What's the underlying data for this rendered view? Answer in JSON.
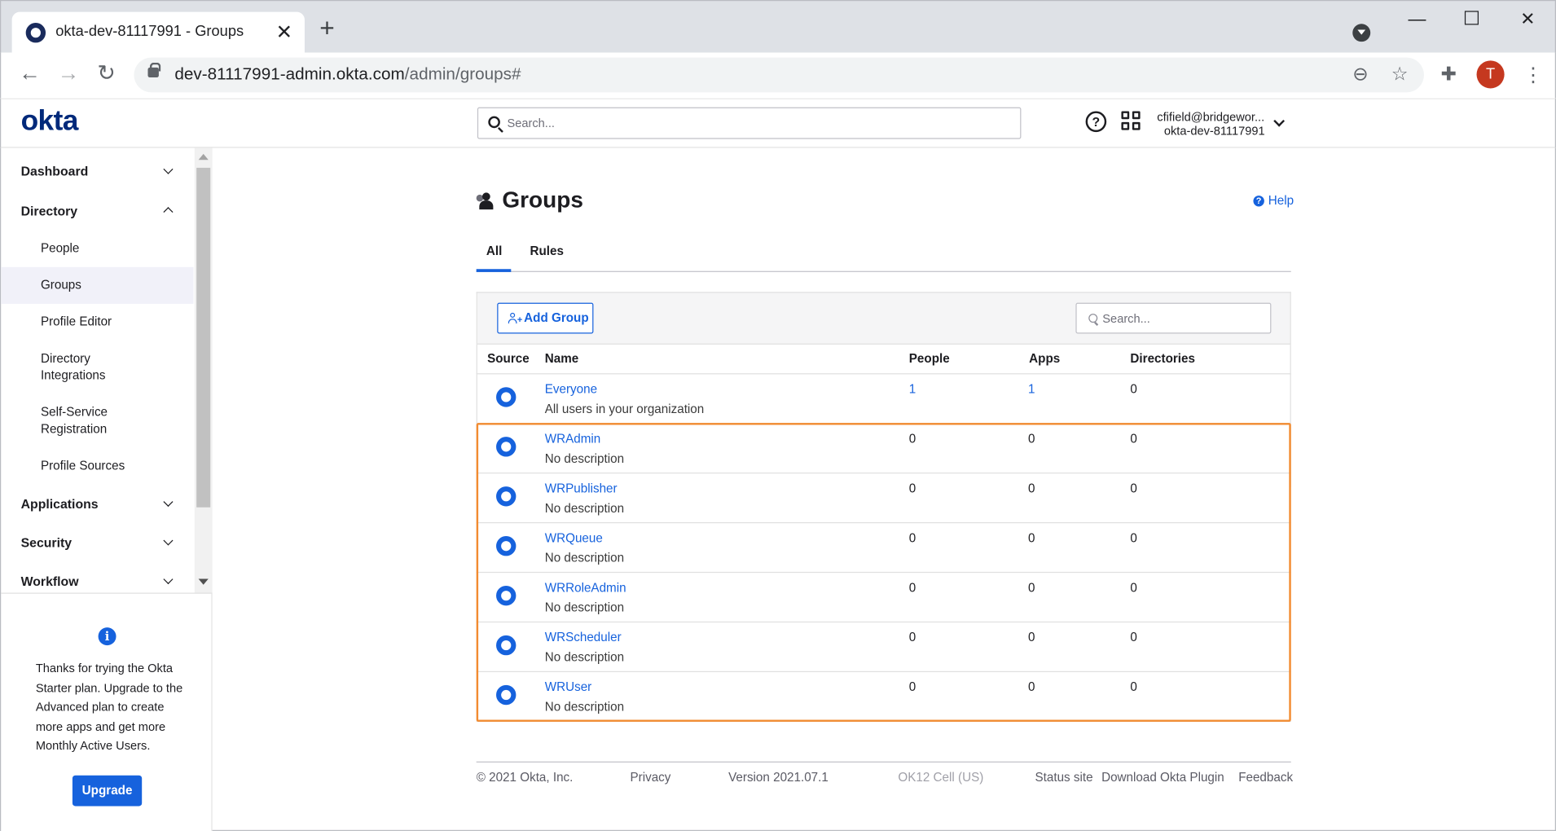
{
  "browser": {
    "tab_title": "okta-dev-81117991 - Groups",
    "url_host": "dev-81117991-admin.okta.com",
    "url_path": "/admin/groups#",
    "profile_initial": "T"
  },
  "header": {
    "logo": "okta",
    "search_placeholder": "Search...",
    "user_email": "cfifield@bridgewor...",
    "user_org": "okta-dev-81117991"
  },
  "sidebar": {
    "dashboard": "Dashboard",
    "directory": "Directory",
    "directory_items": [
      "People",
      "Groups",
      "Profile Editor",
      "Directory Integrations",
      "Self-Service Registration",
      "Profile Sources"
    ],
    "applications": "Applications",
    "security": "Security",
    "workflow": "Workflow",
    "promo_text": "Thanks for trying the Okta Starter plan. Upgrade to the Advanced plan to create more apps and get more Monthly Active Users.",
    "upgrade_label": "Upgrade"
  },
  "main": {
    "title": "Groups",
    "help_label": "Help",
    "tabs": [
      "All",
      "Rules"
    ],
    "add_group_label": "Add Group",
    "table_search_placeholder": "Search...",
    "columns": [
      "Source",
      "Name",
      "People",
      "Apps",
      "Directories"
    ],
    "rows": [
      {
        "name": "Everyone",
        "desc": "All users in your organization",
        "people": "1",
        "apps": "1",
        "dirs": "0"
      },
      {
        "name": "WRAdmin",
        "desc": "No description",
        "people": "0",
        "apps": "0",
        "dirs": "0"
      },
      {
        "name": "WRPublisher",
        "desc": "No description",
        "people": "0",
        "apps": "0",
        "dirs": "0"
      },
      {
        "name": "WRQueue",
        "desc": "No description",
        "people": "0",
        "apps": "0",
        "dirs": "0"
      },
      {
        "name": "WRRoleAdmin",
        "desc": "No description",
        "people": "0",
        "apps": "0",
        "dirs": "0"
      },
      {
        "name": "WRScheduler",
        "desc": "No description",
        "people": "0",
        "apps": "0",
        "dirs": "0"
      },
      {
        "name": "WRUser",
        "desc": "No description",
        "people": "0",
        "apps": "0",
        "dirs": "0"
      }
    ]
  },
  "footer": {
    "copyright": "© 2021 Okta, Inc.",
    "privacy": "Privacy",
    "version": "Version 2021.07.1",
    "cell": "OK12 Cell (US)",
    "status": "Status site",
    "plugin": "Download Okta Plugin",
    "feedback": "Feedback"
  },
  "colors": {
    "accent": "#1662dd",
    "highlight": "#f28b30",
    "logo": "#00297a"
  }
}
